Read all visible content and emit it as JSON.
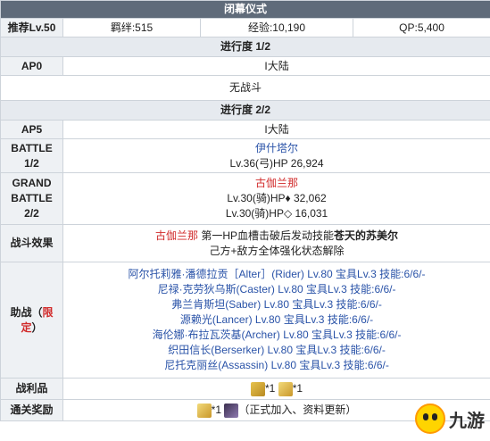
{
  "title": "闭幕仪式",
  "info": {
    "level": "推荐Lv.50",
    "bond": "羁绊:515",
    "exp": "经验:10,190",
    "qp": "QP:5,400"
  },
  "progress1": {
    "heading": "进行度 1/2",
    "ap_label": "AP0",
    "ap_value": "I大陆",
    "note": "无战斗"
  },
  "progress2": {
    "heading": "进行度 2/2",
    "ap_label": "AP5",
    "ap_value": "I大陆",
    "battle1_label": "BATTLE 1/2",
    "battle1_enemy": "伊什塔尔",
    "battle1_stats": "Lv.36(弓)HP 26,924",
    "battle2_label": "GRAND BATTLE 2/2",
    "battle2_enemy": "古伽兰那",
    "battle2_stats_a": "Lv.30(骑)HP♦ 32,062",
    "battle2_stats_b": "Lv.30(骑)HP◇ 16,031"
  },
  "effect": {
    "label": "战斗效果",
    "enemy": "古伽兰那",
    "text1": "第一HP血槽击破后发动技能",
    "skill": "苍天的苏美尔",
    "text2": "己方+敌方全体强化状态解除"
  },
  "support": {
    "label_a": "助战（",
    "label_limited": "限定",
    "label_b": "）",
    "rows": [
      "阿尔托莉雅·潘德拉贡［Alter］(Rider) Lv.80 宝具Lv.3 技能:6/6/-",
      "尼禄·克劳狄乌斯(Caster) Lv.80 宝具Lv.3 技能:6/6/-",
      "弗兰肯斯坦(Saber) Lv.80 宝具Lv.3 技能:6/6/-",
      "源赖光(Lancer) Lv.80 宝具Lv.3 技能:6/6/-",
      "海伦娜·布拉瓦茨基(Archer) Lv.80 宝具Lv.3 技能:6/6/-",
      "织田信长(Berserker) Lv.80 宝具Lv.3 技能:6/6/-",
      "尼托克丽丝(Assassin) Lv.80 宝具Lv.3 技能:6/6/-"
    ]
  },
  "loot": {
    "label": "战利品",
    "count1": "*1",
    "count2": "*1"
  },
  "reward": {
    "label": "通关奖励",
    "count": "*1",
    "note": "（正式加入、资料更新）"
  },
  "logo": {
    "text": "九游",
    "icon": "nine-game-mascot-icon"
  }
}
